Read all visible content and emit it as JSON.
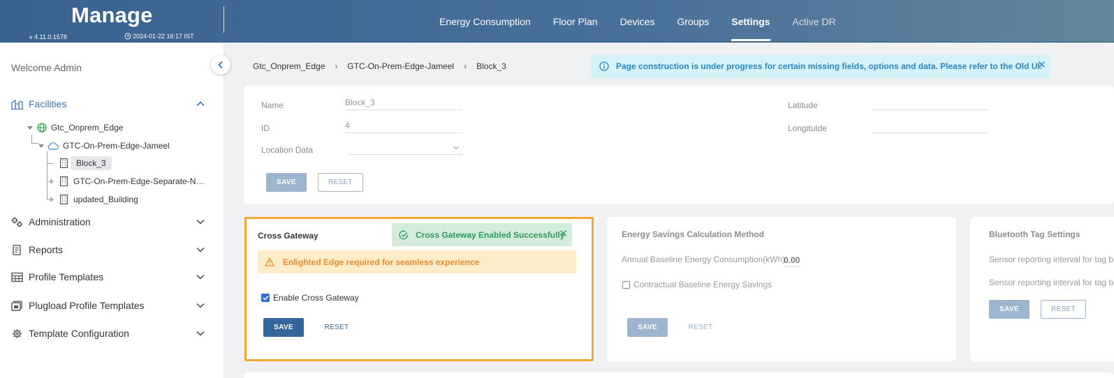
{
  "header": {
    "title": "Manage",
    "version": "v 4.11.0.1578",
    "datetime": "2024-01-22 16:17 IST",
    "nav": [
      {
        "label": "Energy Consumption",
        "active": false
      },
      {
        "label": "Floor Plan",
        "active": false
      },
      {
        "label": "Devices",
        "active": false
      },
      {
        "label": "Groups",
        "active": false
      },
      {
        "label": "Settings",
        "active": true
      },
      {
        "label": "Active DR",
        "active": false
      }
    ]
  },
  "sidebar": {
    "welcome": "Welcome Admin",
    "facilities_label": "Facilities",
    "tree": {
      "root": "Gtc_Onprem_Edge",
      "child": "GTC-On-Prem-Edge-Jameel",
      "leaves": [
        "Block_3",
        "GTC-On-Prem-Edge-Separate-N…",
        "updated_Building"
      ],
      "selected": "Block_3"
    },
    "menu": [
      {
        "label": "Administration",
        "icon": "gears-icon"
      },
      {
        "label": "Reports",
        "icon": "report-icon"
      },
      {
        "label": "Profile Templates",
        "icon": "table-icon"
      },
      {
        "label": "Plugload Profile Templates",
        "icon": "plugload-icon"
      },
      {
        "label": "Template Configuration",
        "icon": "gear-icon"
      }
    ]
  },
  "breadcrumb": [
    "Gtc_Onprem_Edge",
    "GTC-On-Prem-Edge-Jameel",
    "Block_3"
  ],
  "info_banner": "Page construction is under progress for certain missing fields, options and data. Please refer to the Old UI.",
  "details": {
    "name_label": "Name",
    "name_value": "Block_3",
    "id_label": "ID",
    "id_value": "4",
    "location_label": "Location Data",
    "location_value": "",
    "latitude_label": "Latitude",
    "latitude_value": "",
    "longitude_label": "Longitutde",
    "longitude_value": "",
    "save_label": "SAVE",
    "reset_label": "RESET"
  },
  "cross_gateway": {
    "title": "Cross Gateway",
    "toast": "Cross Gateway Enabled Successfully",
    "warning": "Enlighted Edge required for seamless experience",
    "checkbox_label": "Enable Cross Gateway",
    "checked": true,
    "save_label": "SAVE",
    "reset_label": "RESET"
  },
  "energy": {
    "title": "Energy Savings Calculation Method",
    "baseline_label": "Annual Baseline Energy Consumption(kWh)",
    "baseline_value": "0.00",
    "checkbox_label": "Contractual Baseline Energy Savings",
    "checked": false,
    "save_label": "SAVE",
    "reset_label": "RESET"
  },
  "bluetooth": {
    "title": "Bluetooth Tag Settings",
    "line1": "Sensor reporting interval for tag b",
    "line2": "Sensor reporting interval for tag b",
    "save_label": "SAVE",
    "reset_label": "RESET"
  }
}
